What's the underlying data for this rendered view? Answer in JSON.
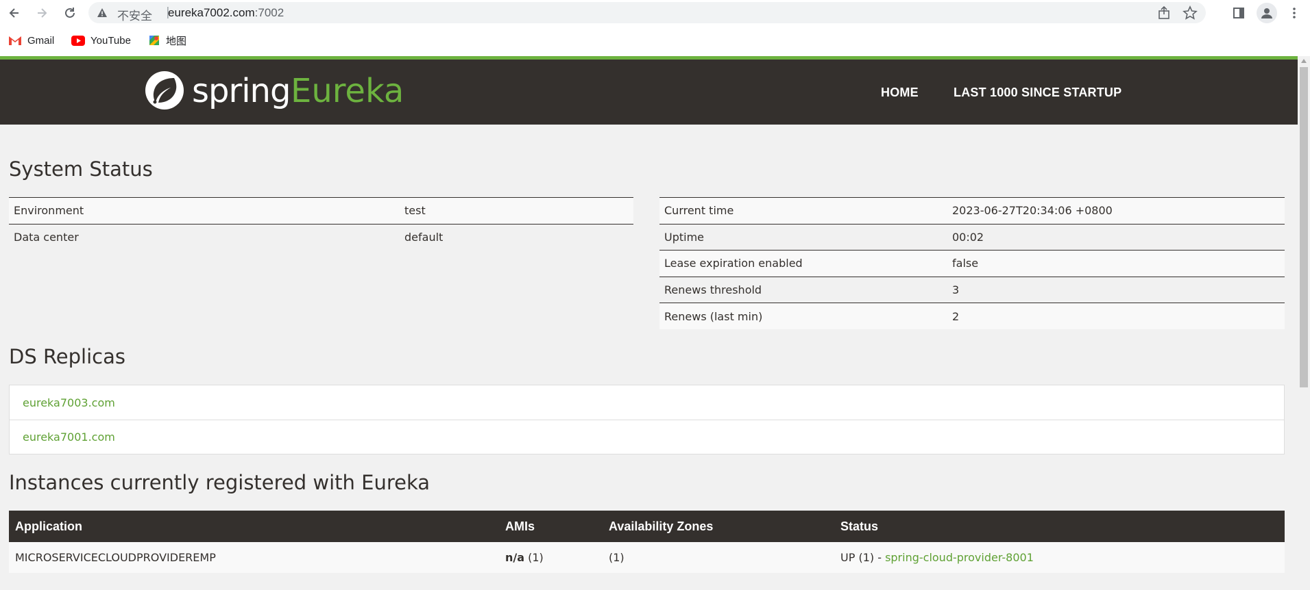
{
  "browser": {
    "security_label": "不安全",
    "url_host": "eureka7002.com",
    "url_port": ":7002",
    "bookmarks": [
      {
        "label": "Gmail",
        "icon": "gmail-icon"
      },
      {
        "label": "YouTube",
        "icon": "youtube-icon"
      },
      {
        "label": "地图",
        "icon": "maps-icon"
      }
    ]
  },
  "navbar": {
    "brand_spring": "spring",
    "brand_eureka": "Eureka",
    "links": [
      "HOME",
      "LAST 1000 SINCE STARTUP"
    ]
  },
  "system_status": {
    "title": "System Status",
    "left": [
      {
        "key": "Environment",
        "value": "test"
      },
      {
        "key": "Data center",
        "value": "default"
      }
    ],
    "right": [
      {
        "key": "Current time",
        "value": "2023-06-27T20:34:06 +0800"
      },
      {
        "key": "Uptime",
        "value": "00:02"
      },
      {
        "key": "Lease expiration enabled",
        "value": "false"
      },
      {
        "key": "Renews threshold",
        "value": "3"
      },
      {
        "key": "Renews (last min)",
        "value": "2"
      }
    ]
  },
  "ds_replicas": {
    "title": "DS Replicas",
    "items": [
      "eureka7003.com",
      "eureka7001.com"
    ]
  },
  "instances": {
    "title": "Instances currently registered with Eureka",
    "columns": [
      "Application",
      "AMIs",
      "Availability Zones",
      "Status"
    ],
    "rows": [
      {
        "application": "MICROSERVICECLOUDPROVIDEREMP",
        "amis_value": "n/a",
        "amis_count": "(1)",
        "zones": "(1)",
        "status_prefix": "UP (1) - ",
        "status_link": "spring-cloud-provider-8001"
      }
    ]
  },
  "colors": {
    "spring_green": "#6db33f",
    "navbar_dark": "#34302d",
    "link_green": "#5fa134"
  }
}
